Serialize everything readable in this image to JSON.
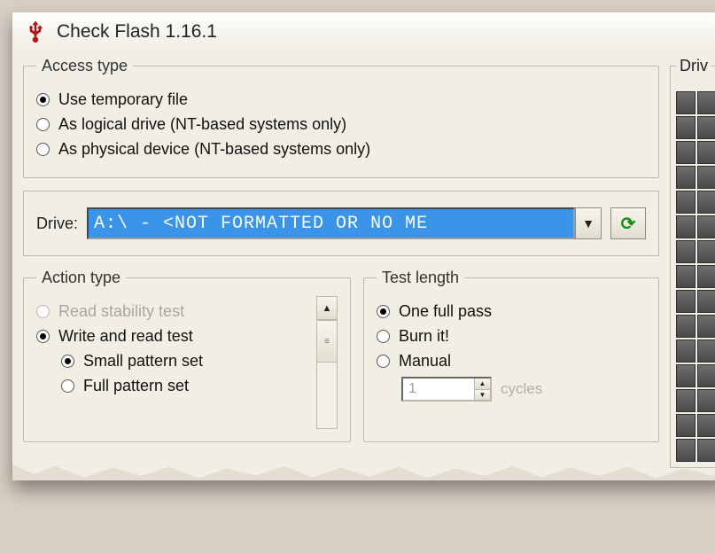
{
  "window": {
    "title": "Check Flash 1.16.1"
  },
  "access_type": {
    "legend": "Access type",
    "options": [
      {
        "label": "Use temporary file",
        "selected": true
      },
      {
        "label": "As logical drive (NT-based systems only)",
        "selected": false
      },
      {
        "label": "As physical device (NT-based systems only)",
        "selected": false
      }
    ]
  },
  "drive": {
    "label": "Drive:",
    "value": "A:\\ - <NOT FORMATTED OR NO ME",
    "refresh_glyph": "⟳"
  },
  "action_type": {
    "legend": "Action type",
    "options": {
      "read_stability": {
        "label": "Read stability test",
        "selected": false,
        "disabled": true
      },
      "write_read": {
        "label": "Write and read test",
        "selected": true,
        "sub": [
          {
            "label": "Small pattern set",
            "selected": true
          },
          {
            "label": "Full pattern set",
            "selected": false
          }
        ]
      }
    }
  },
  "test_length": {
    "legend": "Test length",
    "options": [
      {
        "label": "One full pass",
        "selected": true
      },
      {
        "label": "Burn it!",
        "selected": false
      },
      {
        "label": "Manual",
        "selected": false
      }
    ],
    "cycles_value": "1",
    "cycles_label": "cycles"
  },
  "drive_map": {
    "legend": "Driv"
  }
}
